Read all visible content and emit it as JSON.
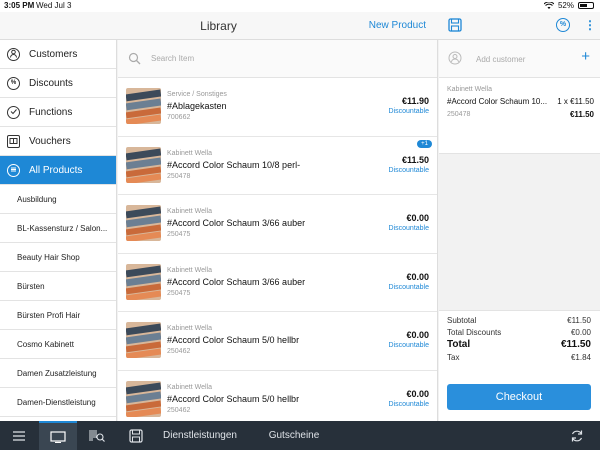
{
  "status_bar": {
    "time": "3:05 PM",
    "date": "Wed Jul 3",
    "battery": "52%"
  },
  "header": {
    "title": "Library",
    "new_product": "New Product",
    "discount_icon": "%"
  },
  "sidebar": {
    "main_items": [
      {
        "label": "Customers",
        "icon": "person-icon",
        "glyph": ""
      },
      {
        "label": "Discounts",
        "icon": "percent-icon",
        "glyph": "%"
      },
      {
        "label": "Functions",
        "icon": "function-icon",
        "glyph": ""
      },
      {
        "label": "Vouchers",
        "icon": "voucher-icon",
        "glyph": ""
      },
      {
        "label": "All Products",
        "icon": "list-icon",
        "glyph": ""
      }
    ],
    "sub_items": [
      "Ausbildung",
      "BL-Kassensturz / Salon...",
      "Beauty Hair Shop",
      "Bürsten",
      "Bürsten Profi Hair",
      "Cosmo Kabinett",
      "Damen Zusatzleistung",
      "Damen-Dienstleistung"
    ]
  },
  "search": {
    "placeholder": "Search Item"
  },
  "products": [
    {
      "category": "Service / Sonstiges",
      "name": "#Ablagekasten",
      "sku": "700662",
      "price": "€11.90",
      "discount_label": "Discountable",
      "badge": ""
    },
    {
      "category": "Kabinett Wella",
      "name": "#Accord Color Schaum 10/8 perl-",
      "sku": "250478",
      "price": "€11.50",
      "discount_label": "Discountable",
      "badge": "+1"
    },
    {
      "category": "Kabinett Wella",
      "name": "#Accord Color Schaum 3/66 auber",
      "sku": "250475",
      "price": "€0.00",
      "discount_label": "Discountable",
      "badge": ""
    },
    {
      "category": "Kabinett Wella",
      "name": "#Accord Color Schaum 3/66 auber",
      "sku": "250475",
      "price": "€0.00",
      "discount_label": "Discountable",
      "badge": ""
    },
    {
      "category": "Kabinett Wella",
      "name": "#Accord Color Schaum 5/0 hellbr",
      "sku": "250462",
      "price": "€0.00",
      "discount_label": "Discountable",
      "badge": ""
    },
    {
      "category": "Kabinett Wella",
      "name": "#Accord Color Schaum 5/0 hellbr",
      "sku": "250462",
      "price": "€0.00",
      "discount_label": "Discountable",
      "badge": ""
    }
  ],
  "cart": {
    "customer_placeholder": "Add customer",
    "items": [
      {
        "category": "Kabinett Wella",
        "name": "#Accord Color Schaum 10...",
        "qty": "1 x €11.50",
        "sku": "250478",
        "price": "€11.50"
      }
    ],
    "totals": {
      "subtotal_label": "Subtotal",
      "subtotal": "€11.50",
      "discounts_label": "Total Discounts",
      "discounts": "€0.00",
      "total_label": "Total",
      "total": "€11.50",
      "tax_label": "Tax",
      "tax": "€1.84"
    },
    "checkout_label": "Checkout"
  },
  "bottom_bar": {
    "services_label": "Dienstleistungen",
    "vouchers_label": "Gutscheine"
  },
  "colors": {
    "accent": "#1e88d6",
    "bottom_bar": "#27303a",
    "checkout": "#2a8fdc"
  }
}
